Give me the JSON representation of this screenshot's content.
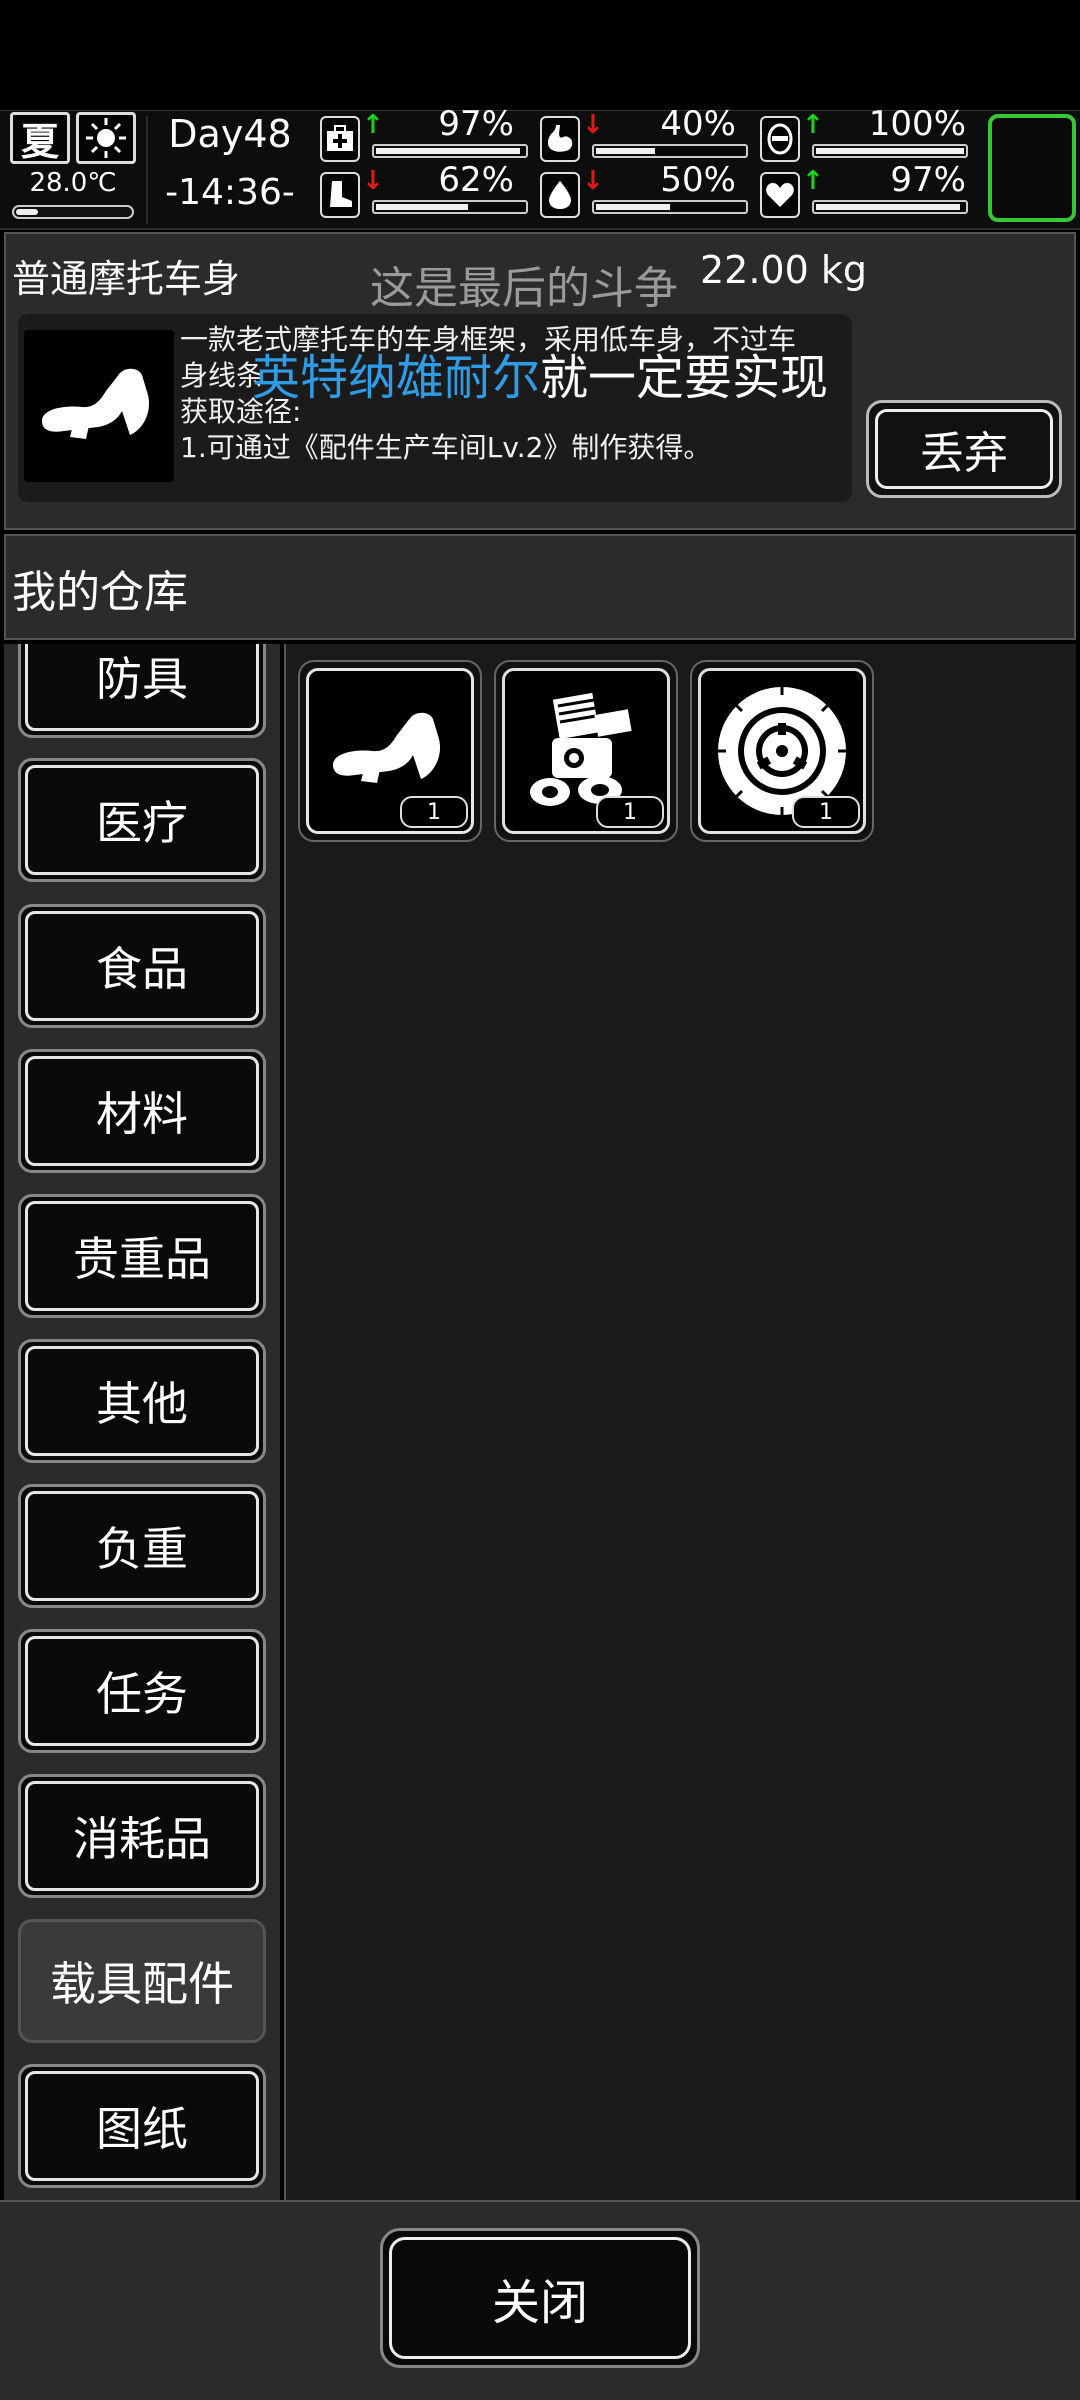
{
  "status": {
    "season": "夏",
    "weather_icon": "sun-icon",
    "temperature": "28.0℃",
    "day": "Day48",
    "clock": "-14:36-",
    "stats": [
      {
        "id": "health",
        "icon": "medkit-icon",
        "trend": "up",
        "value": "97%",
        "level": 0.97
      },
      {
        "id": "hunger",
        "icon": "stomach-icon",
        "trend": "down",
        "value": "40%",
        "level": 0.4
      },
      {
        "id": "mood",
        "icon": "face-icon",
        "trend": "up",
        "value": "100%",
        "level": 1.0
      },
      {
        "id": "stamina",
        "icon": "boot-icon",
        "trend": "down",
        "value": "62%",
        "level": 0.62
      },
      {
        "id": "thirst",
        "icon": "water-drop-icon",
        "trend": "down",
        "value": "50%",
        "level": 0.5
      },
      {
        "id": "spirit",
        "icon": "heart-icon",
        "trend": "up",
        "value": "97%",
        "level": 0.97
      }
    ],
    "accent_color": "#35c735"
  },
  "item_info": {
    "name": "普通摩托车身",
    "banner": "这是最后的斗争",
    "weight": "22.00 kg",
    "description_line1": "一款老式摩托车的车身框架，采用低车身，不过车",
    "description_line2": "身线条",
    "source_label": "获取途径:",
    "source_1": "1.可通过《配件生产车间Lv.2》制作获得。",
    "overlay_blue": "英特纳雄耐尔",
    "overlay_white": "就一定要实现",
    "overlay_blue_color": "#2f9ce6",
    "discard_label": "丢弃"
  },
  "warehouse": {
    "title": "我的仓库",
    "categories": [
      "防具",
      "医疗",
      "食品",
      "材料",
      "贵重品",
      "其他",
      "负重",
      "任务",
      "消耗品",
      "载具配件",
      "图纸"
    ],
    "active_category": "载具配件",
    "items": [
      {
        "name": "motorcycle-body",
        "icon": "motorcycle-body-icon",
        "count": "1"
      },
      {
        "name": "engine",
        "icon": "engine-icon",
        "count": "1"
      },
      {
        "name": "tire",
        "icon": "tire-icon",
        "count": "1"
      }
    ]
  },
  "footer": {
    "close_label": "关闭"
  }
}
